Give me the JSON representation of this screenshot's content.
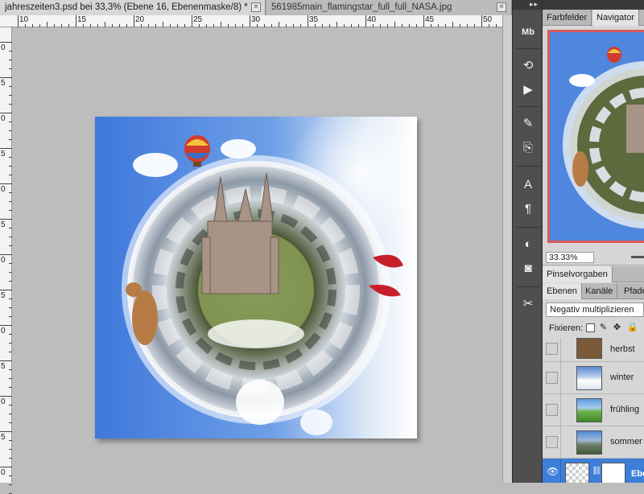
{
  "tabs": [
    {
      "title": "jahreszeiten3.psd bei 33,3% (Ebene 16, Ebenenmaske/8) *",
      "active": true
    },
    {
      "title": "561985main_flamingstar_full_full_NASA.jpg",
      "active": false
    }
  ],
  "ruler": {
    "h_labels": [
      "10",
      "15",
      "20",
      "25",
      "30",
      "35",
      "40",
      "45",
      "50"
    ],
    "v_labels": [
      "0",
      "5",
      "0",
      "5",
      "0",
      "5",
      "0",
      "5",
      "0",
      "5",
      "0",
      "5",
      "0"
    ]
  },
  "toolstrip": {
    "tools": [
      {
        "icon": "mini-bridge-icon",
        "glyph": "Mb"
      },
      {
        "icon": "history-icon",
        "glyph": "⟲"
      },
      {
        "icon": "actions-icon",
        "glyph": "▶"
      },
      {
        "icon": "brush-presets-icon",
        "glyph": "✎"
      },
      {
        "icon": "clone-source-icon",
        "glyph": "⎘"
      },
      {
        "icon": "character-icon",
        "glyph": "A"
      },
      {
        "icon": "paragraph-icon",
        "glyph": "¶"
      },
      {
        "icon": "adjustments-icon",
        "glyph": "◐"
      },
      {
        "icon": "masks-icon",
        "glyph": "◙"
      },
      {
        "icon": "tools-icon",
        "glyph": "✂"
      }
    ]
  },
  "panels": {
    "top_tabs": [
      "Farbfelder",
      "Navigator"
    ],
    "navigator_zoom": "33.33%",
    "brush_tab": "Pinselvorgaben",
    "layer_tabs": [
      "Ebenen",
      "Kanäle",
      "Pfade"
    ],
    "blend_mode": "Negativ multiplizieren",
    "lock_label": "Fixieren:",
    "layers": [
      {
        "name": "herbst",
        "visible": false
      },
      {
        "name": "winter",
        "visible": false
      },
      {
        "name": "frühling",
        "visible": false
      },
      {
        "name": "sommer",
        "visible": false
      },
      {
        "name": "Ebe",
        "visible": true,
        "active": true
      }
    ]
  },
  "colors": {
    "sky": "#4f86de",
    "selection": "#3d7fd8",
    "navigator_frame": "#d85a5a"
  }
}
